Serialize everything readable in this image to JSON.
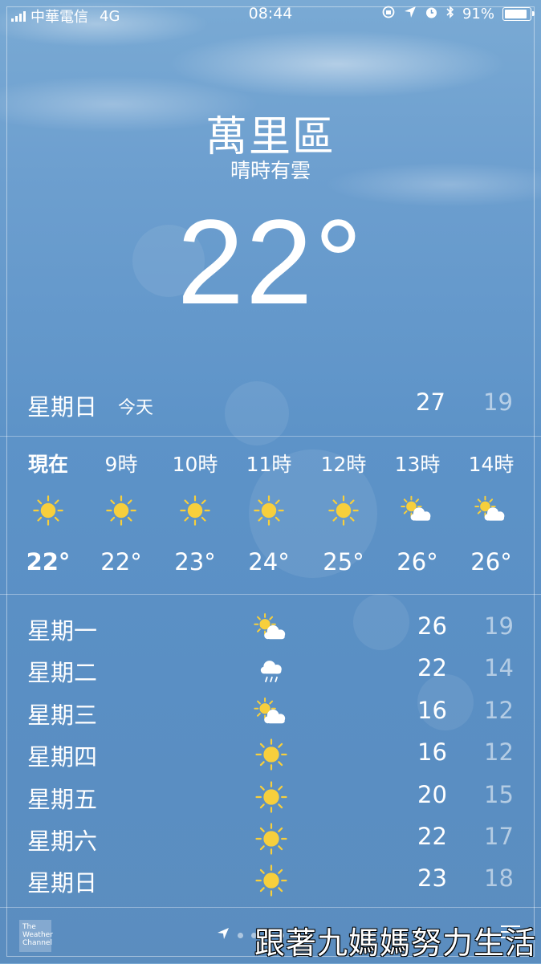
{
  "status_bar": {
    "carrier": "中華電信",
    "network": "4G",
    "time": "08:44",
    "battery": "91%",
    "battery_level": 0.91
  },
  "location": {
    "city": "萬里區",
    "condition": "晴時有雲",
    "current_temp": "22°"
  },
  "today": {
    "day": "星期日",
    "tag": "今天",
    "high": "27",
    "low": "19"
  },
  "hourly": [
    {
      "label": "現在",
      "icon": "sun-icon",
      "temp": "22°"
    },
    {
      "label": "9時",
      "icon": "sun-icon",
      "temp": "22°"
    },
    {
      "label": "10時",
      "icon": "sun-icon",
      "temp": "23°"
    },
    {
      "label": "11時",
      "icon": "sun-icon",
      "temp": "24°"
    },
    {
      "label": "12時",
      "icon": "sun-icon",
      "temp": "25°"
    },
    {
      "label": "13時",
      "icon": "partly-cloudy-icon",
      "temp": "26°"
    },
    {
      "label": "14時",
      "icon": "partly-cloudy-icon",
      "temp": "26°"
    }
  ],
  "daily": [
    {
      "day": "星期一",
      "icon": "partly-cloudy-icon",
      "high": "26",
      "low": "19"
    },
    {
      "day": "星期二",
      "icon": "rain-cloud-icon",
      "high": "22",
      "low": "14"
    },
    {
      "day": "星期三",
      "icon": "partly-cloudy-icon",
      "high": "16",
      "low": "12"
    },
    {
      "day": "星期四",
      "icon": "sun-icon",
      "high": "16",
      "low": "12"
    },
    {
      "day": "星期五",
      "icon": "sun-icon",
      "high": "20",
      "low": "15"
    },
    {
      "day": "星期六",
      "icon": "sun-icon",
      "high": "22",
      "low": "17"
    },
    {
      "day": "星期日",
      "icon": "sun-icon",
      "high": "23",
      "low": "18"
    }
  ],
  "footer": {
    "logo_text": "The Weather Channel",
    "watermark": "跟著九媽媽努力生活"
  },
  "colors": {
    "sun": "#f7cf3c",
    "cloud": "#ffffff",
    "rain": "#ffffff"
  }
}
